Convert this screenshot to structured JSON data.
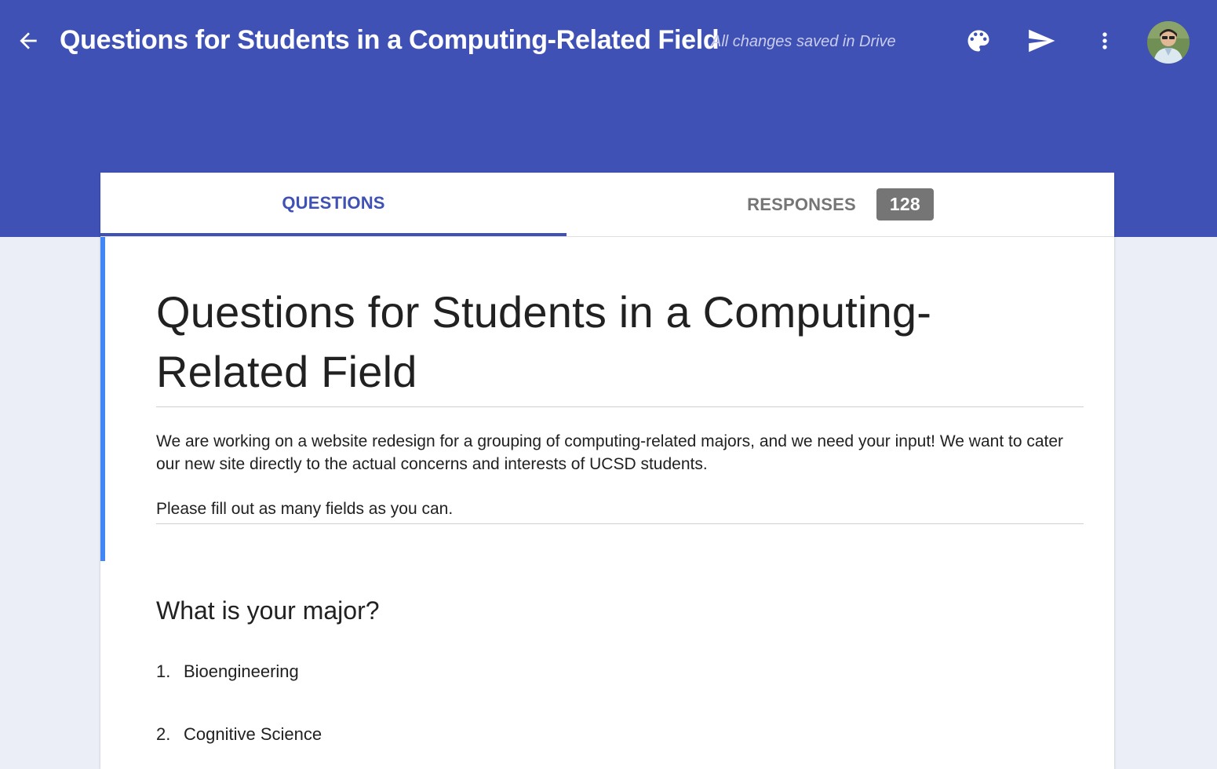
{
  "header": {
    "title": "Questions for Students in a Computing-Related Field",
    "save_status": "All changes saved in Drive",
    "icons": {
      "back": "arrow-left-icon",
      "palette": "palette-icon",
      "send": "send-icon",
      "more": "more-vertical-icon",
      "avatar": "user-avatar"
    },
    "bg_color": "#3f51b5"
  },
  "tabs": [
    {
      "label": "QUESTIONS",
      "active": true
    },
    {
      "label": "RESPONSES",
      "active": false,
      "count": "128"
    }
  ],
  "form": {
    "title": "Questions for Students in a Computing-Related Field",
    "description": [
      "We are working on a website redesign for a grouping of computing-related majors, and we need your input! We want to cater our new site directly to the actual concerns and interests of UCSD students.",
      "Please fill out as many fields as you can."
    ],
    "questions": [
      {
        "title": "What is your major?",
        "options": [
          {
            "num": "1.",
            "label": "Bioengineering"
          },
          {
            "num": "2.",
            "label": "Cognitive Science"
          }
        ]
      }
    ]
  },
  "colors": {
    "accent": "#3f51b5",
    "focus": "#4285f4",
    "page_bg": "#ebedf7"
  }
}
